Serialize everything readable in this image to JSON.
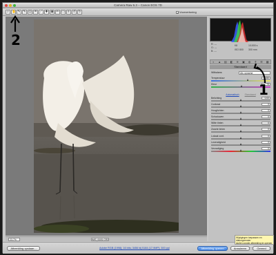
{
  "window": {
    "title": "Camera Raw 6.3  –  Canon EOS 7D"
  },
  "toolbar": {
    "tools": [
      {
        "name": "zoom-tool",
        "glyph": "⌕"
      },
      {
        "name": "hand-tool",
        "glyph": "✋"
      },
      {
        "name": "white-balance-tool",
        "glyph": "✎"
      },
      {
        "name": "color-sampler-tool",
        "glyph": "✎"
      },
      {
        "name": "targeted-adjust-tool",
        "glyph": "◎"
      },
      {
        "name": "crop-tool",
        "glyph": "⌗"
      },
      {
        "name": "straighten-tool",
        "glyph": "⟋"
      },
      {
        "name": "spot-removal-tool",
        "glyph": "✚"
      },
      {
        "name": "red-eye-tool",
        "glyph": "◉"
      },
      {
        "name": "adjustment-brush-tool",
        "glyph": "✏"
      },
      {
        "name": "graduated-filter-tool",
        "glyph": "▭"
      },
      {
        "name": "preferences-tool",
        "glyph": "≡"
      },
      {
        "name": "rotate-left-tool",
        "glyph": "↺"
      },
      {
        "name": "rotate-right-tool",
        "glyph": "↻"
      }
    ],
    "preview_label": "Voorvertoning",
    "preview_checked": "✓"
  },
  "readout": {
    "r": "R:  ---",
    "g": "G:  ---",
    "b": "B:  ---",
    "aperture": "f/8",
    "shutter": "1/1000 s",
    "iso": "ISO 800",
    "focal": "300 mm"
  },
  "panel": {
    "tabs": [
      "◐",
      "▲",
      "▤",
      "◧",
      "≋",
      "▣",
      "◍",
      "⌾",
      "☰",
      "▦"
    ],
    "header": "Standaard",
    "wb_label": "Witbalans:",
    "wb_value": "Als opname",
    "temperature": {
      "label": "Temperatuur",
      "value": "6150",
      "position": 0.62
    },
    "tint": {
      "label": "Kleur",
      "value": "+5",
      "position": 0.52
    },
    "auto_label": "Automatisch",
    "default_label": "Standaard",
    "sliders": [
      {
        "label": "Belichting",
        "value": "0,00",
        "position": 0.5
      },
      {
        "label": "Contrast",
        "value": "0",
        "position": 0.5
      },
      {
        "label": "Hooglichten",
        "value": "0",
        "position": 0.5
      },
      {
        "label": "Schaduwen",
        "value": "0",
        "position": 0.5
      },
      {
        "label": "Witte tinten",
        "value": "0",
        "position": 0.5
      },
      {
        "label": "Zwarte tinten",
        "value": "0",
        "position": 0.5
      }
    ],
    "sliders2": [
      {
        "label": "Lokaal cont.",
        "value": "0",
        "position": 0.5
      },
      {
        "label": "Levendigheid",
        "value": "0",
        "position": 0.5
      },
      {
        "label": "Verzadiging",
        "value": "0",
        "position": 0.5
      }
    ]
  },
  "status": {
    "zoom": "23,7%",
    "filename": "IMG_6181.CR2"
  },
  "bottom": {
    "save_label": "Afbeelding opslaan...",
    "workflow_link": "Adobe RGB (1998); 16 bits; 3456 bij 5184 (17,9MP); 300 ppi",
    "open_label": "Afbeelding openen",
    "cancel_label": "Annuleren",
    "done_label": "Gereed"
  },
  "tooltip": {
    "line1": "Wijzigingen toepassen en dialoogvenster",
    "line2": "sluiten zonder afbeelding te openen"
  },
  "annotations": {
    "number1": "1",
    "number2": "2"
  },
  "colors": {
    "histogram_red": "#e63030",
    "histogram_green": "#3fd43f",
    "histogram_blue": "#3a5cff",
    "link": "#1a45b8"
  }
}
